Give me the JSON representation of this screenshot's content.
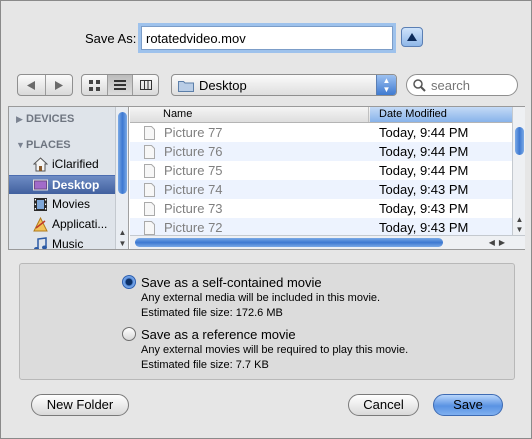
{
  "save": {
    "label": "Save As:",
    "filename": "rotatedvideo.mov"
  },
  "toolbar": {
    "location": "Desktop",
    "search_placeholder": "search"
  },
  "sidebar": {
    "devices_header": "DEVICES",
    "places_header": "PLACES",
    "items": [
      {
        "label": "iClarified",
        "icon": "home-icon"
      },
      {
        "label": "Desktop",
        "icon": "desktop-icon",
        "selected": true
      },
      {
        "label": "Movies",
        "icon": "film-icon"
      },
      {
        "label": "Applicati...",
        "icon": "applications-icon"
      },
      {
        "label": "Music",
        "icon": "music-note-icon"
      }
    ]
  },
  "filelist": {
    "columns": [
      "Name",
      "Date Modified"
    ],
    "rows": [
      {
        "name": "Picture 77",
        "date": "Today, 9:44 PM"
      },
      {
        "name": "Picture 76",
        "date": "Today, 9:44 PM"
      },
      {
        "name": "Picture 75",
        "date": "Today, 9:44 PM"
      },
      {
        "name": "Picture 74",
        "date": "Today, 9:43 PM"
      },
      {
        "name": "Picture 73",
        "date": "Today, 9:43 PM"
      },
      {
        "name": "Picture 72",
        "date": "Today, 9:43 PM"
      }
    ]
  },
  "options": {
    "self_contained": {
      "title": "Save as a self-contained movie",
      "desc": "Any external media will be included in this movie.",
      "size": "Estimated file size:  172.6 MB",
      "selected": true
    },
    "reference": {
      "title": "Save as a reference movie",
      "desc": "Any external movies will be required to play this movie.",
      "size": "Estimated file size:  7.7 KB",
      "selected": false
    }
  },
  "buttons": {
    "new_folder": "New Folder",
    "cancel": "Cancel",
    "save": "Save"
  }
}
